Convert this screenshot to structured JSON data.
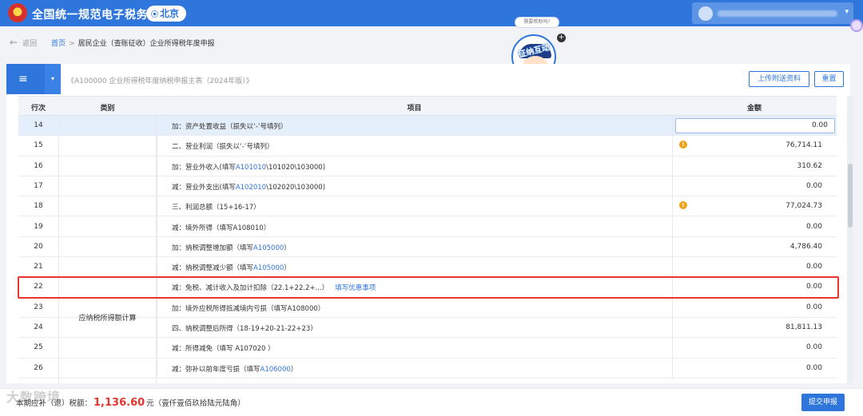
{
  "header": {
    "title": "全国统一规范电子税务局",
    "region": "北京",
    "user": {
      "name": ""
    }
  },
  "nav": {
    "back": "返回",
    "breadcrumb": [
      "首页",
      "居民企业（查账征收）企业所得税年度申报"
    ]
  },
  "help": {
    "bubble": "需要帮助吗?",
    "mascot_text": "征纳互动"
  },
  "form": {
    "title": "《A100000 企业所得税年度纳税申报主表（2024年版）》",
    "upload_button": "上传附送资料",
    "reset_button": "重置",
    "columns": {
      "no": "行次",
      "category": "类别",
      "item": "项目",
      "amount": "金额"
    },
    "category_label": "应纳税所得额计算",
    "rows": [
      {
        "no": "14",
        "prefix": "加：资产处置收益（损失以‘-’号填列）",
        "link": "",
        "suffix": "",
        "extra": "",
        "amount": "0.00",
        "warn": false,
        "selected": true
      },
      {
        "no": "15",
        "prefix": "二、营业利润（损失以‘-’号填列）",
        "link": "",
        "suffix": "",
        "extra": "",
        "amount": "76,714.11",
        "warn": true,
        "selected": false
      },
      {
        "no": "16",
        "prefix": "加：营业外收入(填写",
        "link": "A101010",
        "suffix": "\\101020\\103000)",
        "extra": "",
        "amount": "310.62",
        "warn": false,
        "selected": false
      },
      {
        "no": "17",
        "prefix": "减：营业外支出(填写",
        "link": "A102010",
        "suffix": "\\102020\\103000)",
        "extra": "",
        "amount": "0.00",
        "warn": false,
        "selected": false
      },
      {
        "no": "18",
        "prefix": "三、利润总额（15+16-17）",
        "link": "",
        "suffix": "",
        "extra": "",
        "amount": "77,024.73",
        "warn": true,
        "selected": false
      },
      {
        "no": "19",
        "prefix": "减：境外所得（填写A108010）",
        "link": "",
        "suffix": "",
        "extra": "",
        "amount": "0.00",
        "warn": false,
        "selected": false
      },
      {
        "no": "20",
        "prefix": "加：纳税调整增加额（填写",
        "link": "A105000",
        "suffix": "）",
        "extra": "",
        "amount": "4,786.40",
        "warn": false,
        "selected": false
      },
      {
        "no": "21",
        "prefix": "减：纳税调整减少额（填写",
        "link": "A105000",
        "suffix": "）",
        "extra": "",
        "amount": "0.00",
        "warn": false,
        "selected": false
      },
      {
        "no": "22",
        "prefix": "减：免税、减计收入及加计扣除（22.1+22.2+...）",
        "link": "",
        "suffix": "",
        "extra": "填写优惠事项",
        "amount": "0.00",
        "warn": false,
        "selected": false
      },
      {
        "no": "23",
        "prefix": "加：境外应税所得抵减境内亏损（填写A108000）",
        "link": "",
        "suffix": "",
        "extra": "",
        "amount": "0.00",
        "warn": false,
        "selected": false
      },
      {
        "no": "24",
        "prefix": "四、纳税调整后所得（18-19+20-21-22+23）",
        "link": "",
        "suffix": "",
        "extra": "",
        "amount": "81,811.13",
        "warn": false,
        "selected": false
      },
      {
        "no": "25",
        "prefix": "减：所得减免（填写 A107020 ）",
        "link": "",
        "suffix": "",
        "extra": "",
        "amount": "0.00",
        "warn": false,
        "selected": false
      },
      {
        "no": "26",
        "prefix": "减：弥补以前年度亏损（填写",
        "link": "A106000",
        "suffix": "）",
        "extra": "",
        "amount": "0.00",
        "warn": false,
        "selected": false
      }
    ]
  },
  "footer": {
    "label": "本期应补（退）税额：",
    "amount": "1,136.60",
    "unit": "元",
    "in_words": "（壹仟壹佰玖拾陆元陆角）",
    "submit": "提交申报",
    "watermark": "大数跨境"
  },
  "colors": {
    "primary": "#2f76dc",
    "highlight": "#e8362e",
    "warning": "#f0a21b"
  }
}
